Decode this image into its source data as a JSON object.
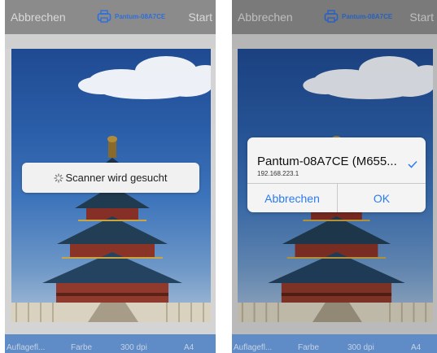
{
  "screens": [
    {
      "topbar": {
        "cancel_label": "Abbrechen",
        "scanner_label": "Pantum-08A7CE",
        "start_label": "Start"
      },
      "toast": {
        "message": "Scanner wird gesucht"
      },
      "settings": {
        "source": "Auflagefl...",
        "color_mode": "Farbe",
        "resolution": "300 dpi",
        "paper_size": "A4"
      }
    },
    {
      "topbar": {
        "cancel_label": "Abbrechen",
        "scanner_label": "Pantum-08A7CE",
        "start_label": "Start"
      },
      "dialog": {
        "printer_name": "Pantum-08A7CE (M655...",
        "printer_ip": "192.168.223.1",
        "selected": true,
        "cancel_label": "Abbrechen",
        "ok_label": "OK"
      },
      "settings": {
        "source": "Auflagefl...",
        "color_mode": "Farbe",
        "resolution": "300 dpi",
        "paper_size": "A4"
      }
    }
  ],
  "icons": {
    "scanner": "printer-icon",
    "spinner": "spinner-icon",
    "check": "checkmark-icon"
  },
  "colors": {
    "accent": "#2b7bf0",
    "topbar": "#8b8b8b",
    "bottombar": "#5f8bc6"
  }
}
